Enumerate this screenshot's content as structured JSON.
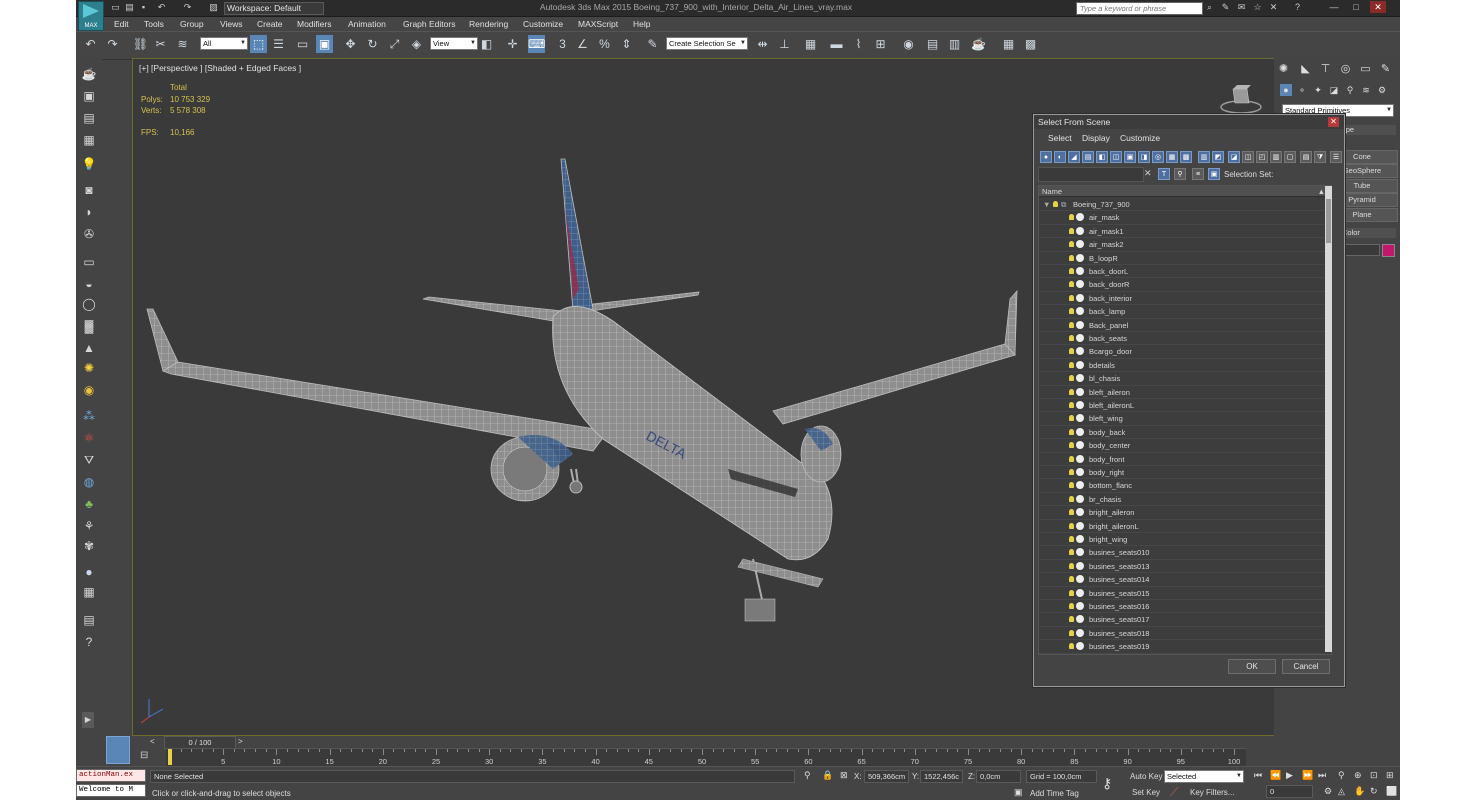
{
  "window": {
    "logo_text": "MAX",
    "workspace": "Workspace: Default",
    "title": "Autodesk 3ds Max 2015    Boeing_737_900_with_Interior_Delta_Air_Lines_vray.max",
    "search_placeholder": "Type a keyword or phrase"
  },
  "menu": [
    "Edit",
    "Tools",
    "Group",
    "Views",
    "Create",
    "Modifiers",
    "Animation",
    "Graph Editors",
    "Rendering",
    "Customize",
    "MAXScript",
    "Help"
  ],
  "toolbar": {
    "selection_filter": "All",
    "ref_coord": "View",
    "named_selection": "Create Selection Se"
  },
  "viewport": {
    "label": "[+] [Perspective ] [Shaded + Edged Faces ]",
    "stats_header": "Total",
    "polys_label": "Polys:",
    "polys_value": "10 753 329",
    "verts_label": "Verts:",
    "verts_value": "5 578 308",
    "fps_label": "FPS:",
    "fps_value": "10,166"
  },
  "command_panel": {
    "category": "Standard Primitives",
    "rollout_type": "ype",
    "buttons": [
      "Cone",
      "GeoSphere",
      "Tube",
      "Pyramid",
      "Plane"
    ],
    "color_rollout": "Color",
    "color_swatch": "#c2186c"
  },
  "dialog": {
    "title": "Select From Scene",
    "menus": [
      "Select",
      "Display",
      "Customize"
    ],
    "selection_set_label": "Selection Set:",
    "column_name": "Name",
    "root": "Boeing_737_900",
    "items": [
      "air_mask",
      "air_mask1",
      "air_mask2",
      "B_loopR",
      "back_doorL",
      "back_doorR",
      "back_interior",
      "back_lamp",
      "Back_panel",
      "back_seats",
      "Bcargo_door",
      "bdetails",
      "bl_chasis",
      "bleft_aileron",
      "bleft_aileronL",
      "bleft_wing",
      "body_back",
      "body_center",
      "body_front",
      "body_right",
      "bottom_flanc",
      "br_chasis",
      "bright_aileron",
      "bright_aileronL",
      "bright_wing",
      "busines_seats010",
      "busines_seats013",
      "busines_seats014",
      "busines_seats015",
      "busines_seats016",
      "busines_seats017",
      "busines_seats018",
      "busines_seats019"
    ],
    "ok_label": "OK",
    "cancel_label": "Cancel"
  },
  "timeline": {
    "frame": "0 / 100",
    "ticks": [
      "5",
      "10",
      "15",
      "20",
      "25",
      "30",
      "35",
      "40",
      "45",
      "50",
      "55",
      "60",
      "65",
      "70",
      "75",
      "80",
      "85",
      "90",
      "95",
      "100"
    ]
  },
  "status": {
    "listener_1": "actionMan.ex",
    "listener_2": "Welcome to M",
    "selection": "None Selected",
    "prompt": "Click or click-and-drag to select objects",
    "x_label": "X:",
    "x_value": "509,366cm",
    "y_label": "Y:",
    "y_value": "1522,456c",
    "z_label": "Z:",
    "z_value": "0,0cm",
    "grid": "Grid = 100,0cm",
    "add_time_tag": "Add Time Tag",
    "auto_key": "Auto Key",
    "set_key": "Set Key",
    "key_mode": "Selected",
    "key_filters": "Key Filters...",
    "frame_field": "0"
  }
}
